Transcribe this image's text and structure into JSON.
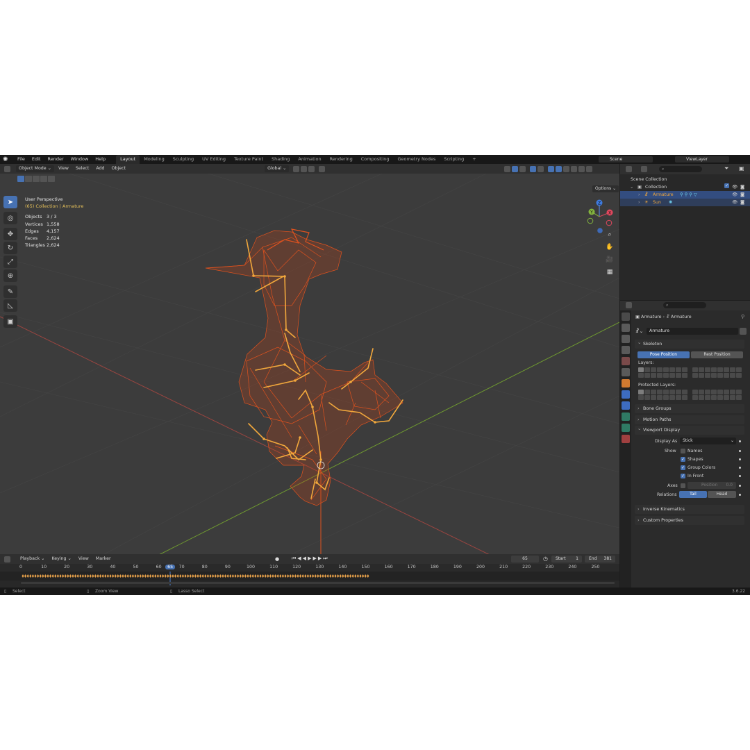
{
  "menu": [
    "File",
    "Edit",
    "Render",
    "Window",
    "Help"
  ],
  "workspaces": [
    "Layout",
    "Modeling",
    "Sculpting",
    "UV Editing",
    "Texture Paint",
    "Shading",
    "Animation",
    "Rendering",
    "Compositing",
    "Geometry Nodes",
    "Scripting"
  ],
  "active_workspace": "Layout",
  "scene": "Scene",
  "view_layer": "ViewLayer",
  "viewport": {
    "mode": "Object Mode",
    "menus": [
      "View",
      "Select",
      "Add",
      "Object"
    ],
    "transform_orientation": "Global",
    "options_label": "Options",
    "view_name": "User Perspective",
    "collection_info": "(65) Collection | Armature",
    "stats": [
      {
        "label": "Objects",
        "value": "3 / 3"
      },
      {
        "label": "Vertices",
        "value": "1,558"
      },
      {
        "label": "Edges",
        "value": "4,157"
      },
      {
        "label": "Faces",
        "value": "2,624"
      },
      {
        "label": "Triangles",
        "value": "2,624"
      }
    ],
    "gizmo_axes": [
      "X",
      "Y",
      "Z"
    ]
  },
  "timeline": {
    "menus": [
      "Playback",
      "Keying",
      "View",
      "Marker"
    ],
    "current_frame": "65",
    "start_label": "Start",
    "start": "1",
    "end_label": "End",
    "end": "381",
    "ruler": [
      "0",
      "10",
      "20",
      "30",
      "40",
      "50",
      "60",
      "65",
      "70",
      "80",
      "90",
      "100",
      "110",
      "120",
      "130",
      "140",
      "150",
      "160",
      "170",
      "180",
      "190",
      "200",
      "210",
      "220",
      "230",
      "240",
      "250"
    ]
  },
  "status": {
    "select": "Select",
    "zoom": "Zoom View",
    "lasso": "Lasso Select",
    "version": "3.6.22"
  },
  "outliner": {
    "scene_collection": "Scene Collection",
    "collection": "Collection",
    "items": [
      "Armature",
      "Sun"
    ]
  },
  "properties": {
    "breadcrumb": [
      "Armature",
      "Armature"
    ],
    "data_name": "Armature",
    "skeleton": {
      "title": "Skeleton",
      "pose_position": "Pose Position",
      "rest_position": "Rest Position",
      "layers": "Layers:",
      "protected_layers": "Protected Layers:"
    },
    "bone_groups": "Bone Groups",
    "motion_paths": "Motion Paths",
    "viewport_display": {
      "title": "Viewport Display",
      "display_as_label": "Display As",
      "display_as": "Stick",
      "show_label": "Show",
      "names": "Names",
      "shapes": "Shapes",
      "group_colors": "Group Colors",
      "in_front": "In Front",
      "axes_label": "Axes",
      "position_label": "Position",
      "position_value": "0.0",
      "relations_label": "Relations",
      "tail": "Tail",
      "head": "Head"
    },
    "inverse_kinematics": "Inverse Kinematics",
    "custom_properties": "Custom Properties"
  },
  "colors": {
    "wire": "#e0521e",
    "bones": "#f2a83c",
    "accent": "#4772b3",
    "grid_x": "#a8453f",
    "grid_y": "#6b9b2c"
  }
}
